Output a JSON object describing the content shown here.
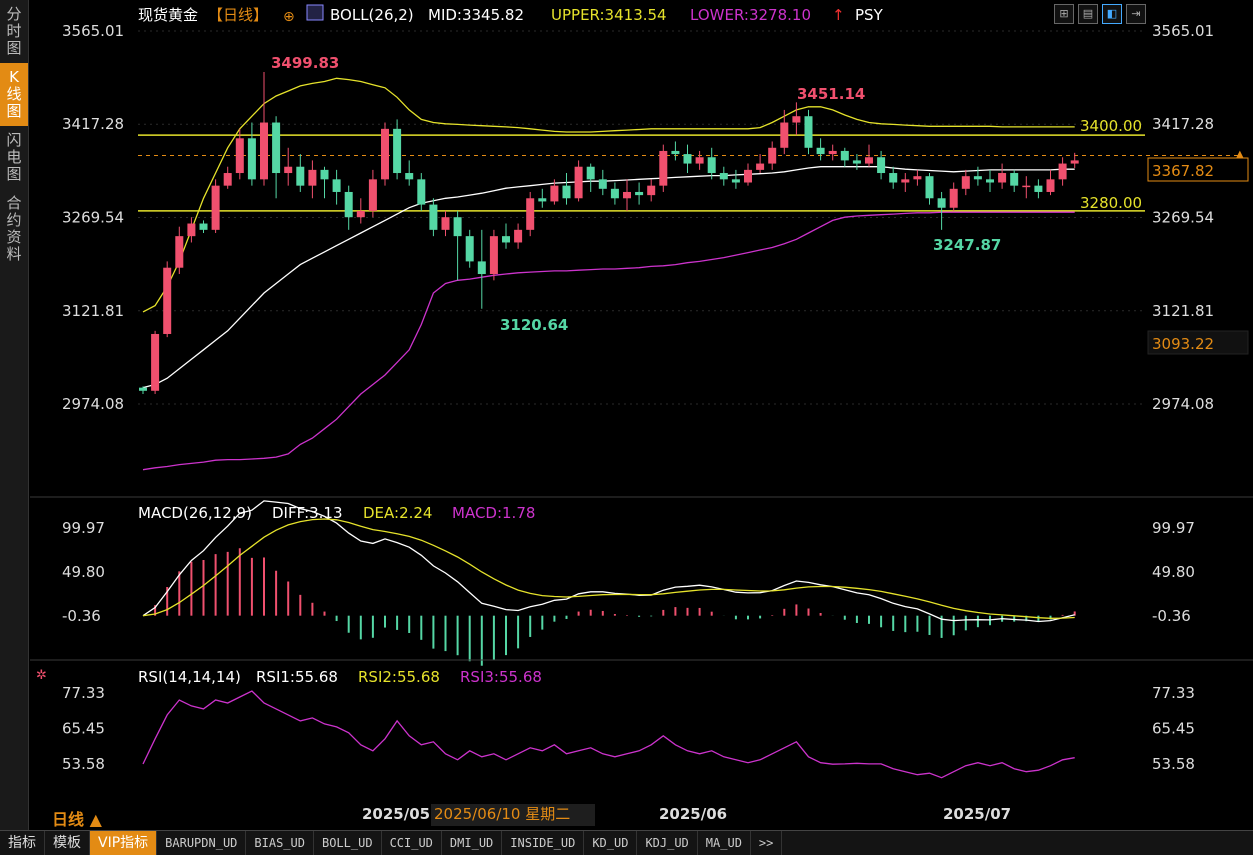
{
  "sidebar": {
    "tabs": [
      {
        "label": "分时图",
        "active": false
      },
      {
        "label": "K线图",
        "active": true
      },
      {
        "label": "闪电图",
        "active": false
      },
      {
        "label": "合约资料",
        "active": false
      }
    ]
  },
  "header": {
    "name": "现货黄金",
    "period": "【日线】",
    "boll": "BOLL(26,2)",
    "mid": "MID:3345.82",
    "upper": "UPPER:3413.54",
    "lower": "LOWER:3278.10",
    "psy": "PSY"
  },
  "toolbar_icons": [
    "grid-icon",
    "layout-icon",
    "chart-view-icon",
    "export-icon"
  ],
  "colors": {
    "up": "#f0506e",
    "down": "#55d7a5",
    "mid": "#ffffff",
    "upper": "#e5e22b",
    "lower": "#cc33cc",
    "accent": "#e38b14",
    "grid": "#2a2a2a"
  },
  "price_axis": {
    "ticks": [
      "3565.01",
      "3417.28",
      "3269.54",
      "3121.81",
      "2974.08"
    ],
    "current_price": "3367.82",
    "box_price": "3093.22"
  },
  "annotations": {
    "high1": "3499.83",
    "high2": "3451.14",
    "low1": "3120.64",
    "low2": "3247.87",
    "level_high": "3400.00",
    "level_low": "3280.00"
  },
  "macd": {
    "title": "MACD(26,12,9)",
    "diff": "DIFF:3.13",
    "dea": "DEA:2.24",
    "macd": "MACD:1.78",
    "ticks": [
      "99.97",
      "49.80",
      "-0.36"
    ]
  },
  "rsi": {
    "title": "RSI(14,14,14)",
    "rsi1": "RSI1:55.68",
    "rsi2": "RSI2:55.68",
    "rsi3": "RSI3:55.68",
    "ticks": [
      "77.33",
      "65.45",
      "53.58"
    ]
  },
  "xaxis": {
    "labels": [
      "2025/05",
      "2025/06",
      "2025/07"
    ],
    "cursor_date": "2025/06/10 星期二"
  },
  "period_button": "日线 ▲",
  "bottom_tabs": [
    "指标",
    "模板",
    "VIP指标",
    "BARUPDN_UD",
    "BIAS_UD",
    "BOLL_UD",
    "CCI_UD",
    "DMI_UD",
    "INSIDE_UD",
    "KD_UD",
    "KDJ_UD",
    "MA_UD",
    ">>"
  ],
  "chart_data": {
    "type": "candlestick",
    "y_range": [
      2974.08,
      3565.01
    ],
    "candles": [
      [
        3000,
        2995,
        3002,
        2990
      ],
      [
        2995,
        3085,
        3090,
        2990
      ],
      [
        3085,
        3190,
        3200,
        3080
      ],
      [
        3190,
        3240,
        3255,
        3180
      ],
      [
        3240,
        3260,
        3270,
        3230
      ],
      [
        3260,
        3250,
        3265,
        3245
      ],
      [
        3250,
        3320,
        3330,
        3245
      ],
      [
        3320,
        3340,
        3350,
        3315
      ],
      [
        3340,
        3395,
        3410,
        3330
      ],
      [
        3395,
        3330,
        3420,
        3320
      ],
      [
        3330,
        3420,
        3500,
        3320
      ],
      [
        3420,
        3340,
        3430,
        3300
      ],
      [
        3340,
        3350,
        3380,
        3320
      ],
      [
        3350,
        3320,
        3370,
        3310
      ],
      [
        3320,
        3345,
        3360,
        3300
      ],
      [
        3345,
        3330,
        3350,
        3300
      ],
      [
        3330,
        3310,
        3345,
        3290
      ],
      [
        3310,
        3270,
        3320,
        3250
      ],
      [
        3270,
        3280,
        3300,
        3260
      ],
      [
        3280,
        3330,
        3345,
        3270
      ],
      [
        3330,
        3410,
        3420,
        3320
      ],
      [
        3410,
        3340,
        3425,
        3330
      ],
      [
        3340,
        3330,
        3360,
        3320
      ],
      [
        3330,
        3290,
        3340,
        3280
      ],
      [
        3290,
        3250,
        3300,
        3240
      ],
      [
        3250,
        3270,
        3280,
        3240
      ],
      [
        3270,
        3240,
        3280,
        3170
      ],
      [
        3240,
        3200,
        3250,
        3190
      ],
      [
        3200,
        3180,
        3250,
        3125
      ],
      [
        3180,
        3240,
        3250,
        3170
      ],
      [
        3240,
        3230,
        3260,
        3220
      ],
      [
        3230,
        3250,
        3260,
        3220
      ],
      [
        3250,
        3300,
        3310,
        3240
      ],
      [
        3300,
        3295,
        3315,
        3285
      ],
      [
        3295,
        3320,
        3330,
        3290
      ],
      [
        3320,
        3300,
        3340,
        3290
      ],
      [
        3300,
        3350,
        3360,
        3295
      ],
      [
        3350,
        3330,
        3355,
        3310
      ],
      [
        3330,
        3315,
        3345,
        3305
      ],
      [
        3315,
        3300,
        3325,
        3290
      ],
      [
        3300,
        3310,
        3330,
        3280
      ],
      [
        3310,
        3305,
        3325,
        3290
      ],
      [
        3305,
        3320,
        3330,
        3295
      ],
      [
        3320,
        3375,
        3385,
        3310
      ],
      [
        3375,
        3370,
        3390,
        3360
      ],
      [
        3370,
        3355,
        3385,
        3340
      ],
      [
        3355,
        3365,
        3375,
        3345
      ],
      [
        3365,
        3340,
        3380,
        3330
      ],
      [
        3340,
        3330,
        3350,
        3320
      ],
      [
        3330,
        3325,
        3345,
        3315
      ],
      [
        3325,
        3345,
        3355,
        3320
      ],
      [
        3345,
        3355,
        3370,
        3340
      ],
      [
        3355,
        3380,
        3390,
        3345
      ],
      [
        3380,
        3420,
        3440,
        3370
      ],
      [
        3420,
        3430,
        3452,
        3400
      ],
      [
        3430,
        3380,
        3440,
        3370
      ],
      [
        3380,
        3370,
        3395,
        3360
      ],
      [
        3370,
        3375,
        3385,
        3360
      ],
      [
        3375,
        3360,
        3380,
        3350
      ],
      [
        3360,
        3355,
        3370,
        3345
      ],
      [
        3355,
        3365,
        3385,
        3350
      ],
      [
        3365,
        3340,
        3375,
        3330
      ],
      [
        3340,
        3325,
        3350,
        3315
      ],
      [
        3325,
        3330,
        3340,
        3310
      ],
      [
        3330,
        3335,
        3345,
        3320
      ],
      [
        3335,
        3300,
        3340,
        3290
      ],
      [
        3300,
        3285,
        3310,
        3250
      ],
      [
        3285,
        3315,
        3325,
        3280
      ],
      [
        3315,
        3335,
        3345,
        3305
      ],
      [
        3335,
        3330,
        3350,
        3320
      ],
      [
        3330,
        3325,
        3345,
        3310
      ],
      [
        3325,
        3340,
        3355,
        3315
      ],
      [
        3340,
        3320,
        3345,
        3310
      ],
      [
        3320,
        3320,
        3335,
        3300
      ],
      [
        3320,
        3310,
        3330,
        3300
      ],
      [
        3310,
        3330,
        3345,
        3305
      ],
      [
        3330,
        3355,
        3365,
        3320
      ],
      [
        3355,
        3360,
        3372,
        3348
      ]
    ],
    "boll_mid": [
      3000,
      3005,
      3015,
      3030,
      3045,
      3060,
      3075,
      3090,
      3110,
      3130,
      3150,
      3165,
      3180,
      3195,
      3205,
      3215,
      3225,
      3235,
      3245,
      3255,
      3265,
      3275,
      3285,
      3292,
      3296,
      3300,
      3302,
      3305,
      3308,
      3312,
      3316,
      3318,
      3320,
      3322,
      3324,
      3325,
      3326,
      3327,
      3327,
      3328,
      3329,
      3330,
      3331,
      3332,
      3333,
      3334,
      3335,
      3336,
      3336,
      3337,
      3338,
      3339,
      3340,
      3342,
      3345,
      3348,
      3350,
      3350,
      3350,
      3350,
      3350,
      3350,
      3348,
      3346,
      3345,
      3344,
      3343,
      3342,
      3343,
      3344,
      3345,
      3345,
      3345,
      3345,
      3345,
      3345,
      3346,
      3346
    ],
    "boll_upper": [
      3120,
      3130,
      3160,
      3200,
      3250,
      3300,
      3340,
      3380,
      3410,
      3430,
      3450,
      3462,
      3470,
      3478,
      3482,
      3485,
      3490,
      3488,
      3485,
      3480,
      3475,
      3460,
      3440,
      3425,
      3420,
      3418,
      3417,
      3416,
      3415,
      3414,
      3413,
      3412,
      3410,
      3408,
      3406,
      3405,
      3405,
      3405,
      3406,
      3407,
      3408,
      3409,
      3410,
      3410,
      3410,
      3410,
      3410,
      3410,
      3410,
      3410,
      3410,
      3412,
      3420,
      3430,
      3440,
      3445,
      3445,
      3440,
      3432,
      3425,
      3420,
      3418,
      3417,
      3416,
      3415,
      3414,
      3414,
      3414,
      3414,
      3414,
      3414,
      3413,
      3413,
      3413,
      3413,
      3413,
      3413,
      3413
    ],
    "boll_lower": [
      2870,
      2873,
      2875,
      2878,
      2880,
      2882,
      2885,
      2886,
      2886,
      2887,
      2888,
      2890,
      2895,
      2910,
      2920,
      2935,
      2950,
      2970,
      2990,
      3005,
      3020,
      3040,
      3060,
      3100,
      3150,
      3165,
      3170,
      3172,
      3175,
      3178,
      3180,
      3182,
      3183,
      3184,
      3185,
      3185,
      3186,
      3187,
      3188,
      3188,
      3189,
      3190,
      3192,
      3193,
      3195,
      3198,
      3200,
      3203,
      3206,
      3210,
      3214,
      3218,
      3222,
      3228,
      3235,
      3245,
      3255,
      3265,
      3270,
      3272,
      3273,
      3274,
      3275,
      3276,
      3277,
      3277,
      3278,
      3278,
      3278,
      3278,
      3278,
      3278,
      3278,
      3278,
      3278,
      3278,
      3278,
      3278
    ],
    "rsi": [
      53.58,
      62,
      70,
      75,
      73,
      72,
      75,
      74,
      76,
      78,
      74,
      72,
      70,
      68,
      69,
      67,
      66,
      64,
      60,
      58,
      62,
      68,
      63,
      60,
      61,
      57,
      55,
      58,
      56,
      57,
      55,
      57,
      59,
      58,
      60,
      57,
      58,
      59,
      57,
      56,
      57,
      58,
      60,
      63,
      60,
      58,
      57,
      58,
      56,
      55,
      54,
      55,
      57,
      59,
      61,
      56,
      54,
      53.5,
      53.6,
      53.8,
      53.6,
      53.6,
      52,
      51,
      50,
      50.5,
      49,
      51,
      53,
      54,
      53,
      54,
      52,
      51,
      51.5,
      53,
      55,
      55.7
    ]
  }
}
